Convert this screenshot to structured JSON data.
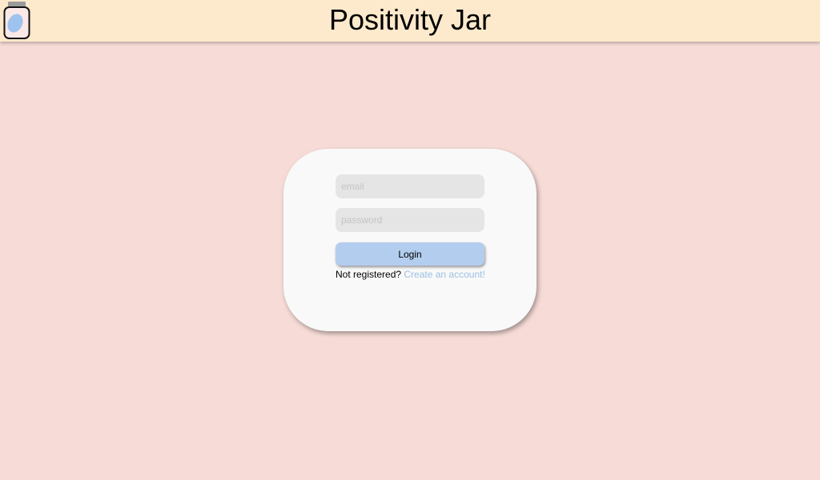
{
  "header": {
    "title": "Positivity Jar",
    "logo_icon": "jar-icon"
  },
  "login_form": {
    "email": {
      "value": "",
      "placeholder": "email"
    },
    "password": {
      "value": "",
      "placeholder": "password"
    },
    "login_label": "Login",
    "register_prompt": "Not registered?",
    "register_link": "Create an account!"
  },
  "colors": {
    "background": "#f7dbd7",
    "header": "#fde9cb",
    "card": "#f9f9f9",
    "button": "#b3cdee",
    "link": "#9bbfe3"
  }
}
